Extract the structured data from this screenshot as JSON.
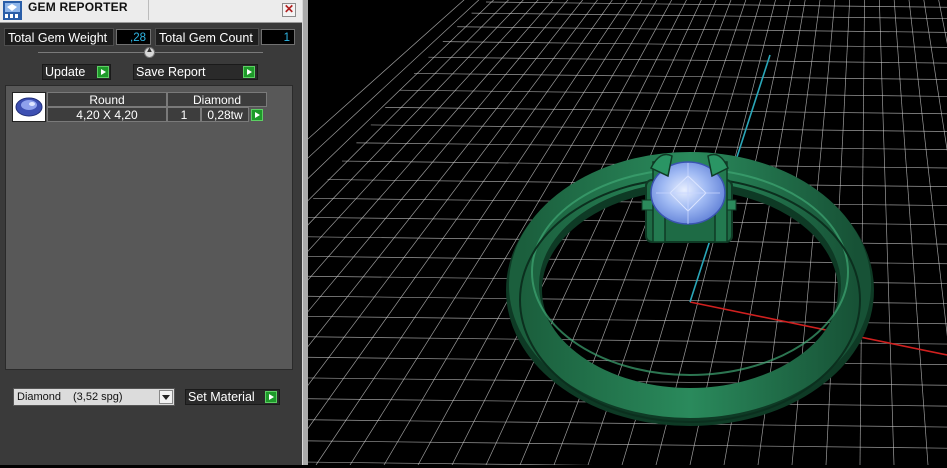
{
  "panel": {
    "title": "GEM REPORTER",
    "close_glyph": "✕",
    "total_weight": {
      "label": "Total Gem Weight",
      "value": ",28"
    },
    "total_count": {
      "label": "Total Gem Count",
      "value": "1"
    },
    "buttons": {
      "update": "Update",
      "save_report": "Save Report",
      "set_material": "Set Material"
    },
    "gem_table": {
      "headers": [
        "Round",
        "Diamond"
      ],
      "row": {
        "size": "4,20 X 4,20",
        "count": "1",
        "weight": "0,28tw"
      }
    },
    "material": {
      "value": "Diamond",
      "spg": "(3,52 spg)"
    }
  },
  "icons": [
    "gem-reporter-app-icon",
    "close-icon",
    "slider-knob-icon",
    "play-arrow-icon",
    "gem-thumbnail-icon",
    "chevron-down-icon"
  ],
  "colors": {
    "panel_bg": "#3a3a3a",
    "value_text": "#2fb7e6",
    "play_green": "#1e9a2a",
    "ring_green": "#1f6e48",
    "gem_blue": "#93b2ee",
    "grid_line": "#cfcfcf",
    "axis_red": "#d0201f",
    "axis_cyan": "#2aa7b9"
  }
}
